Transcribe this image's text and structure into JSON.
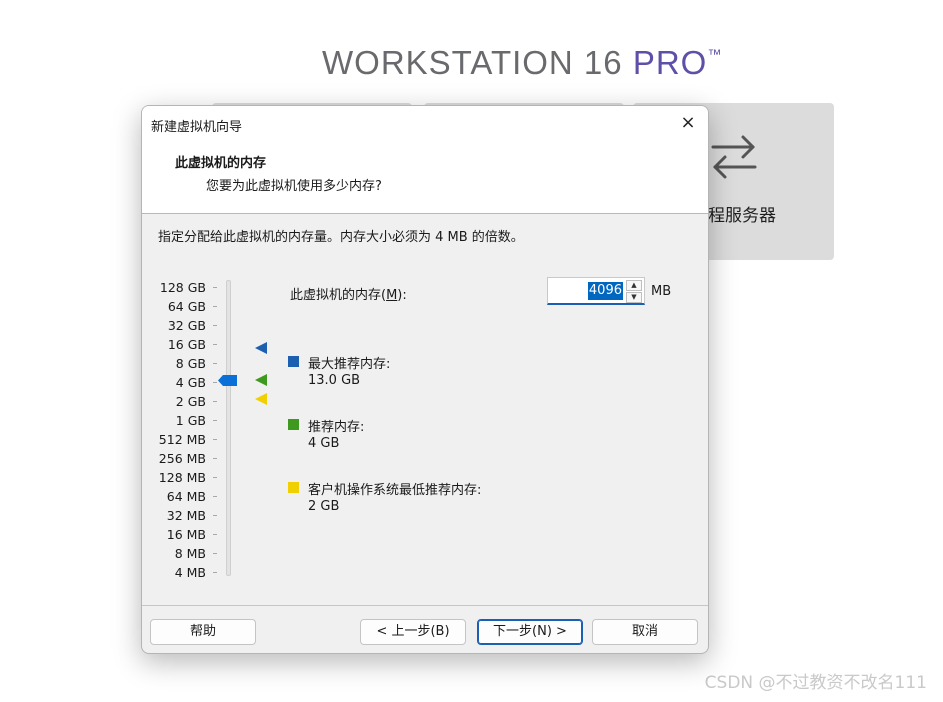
{
  "background": {
    "product_title": "WORKSTATION 16",
    "product_title_pro": "PRO",
    "product_title_tm": "™",
    "remote_server_label": "远程服务器",
    "remote_server_icon": "transfer-arrows-icon"
  },
  "watermark": "CSDN @不过教资不改名111",
  "dialog": {
    "title": "新建虚拟机向导",
    "close_icon": "×",
    "heading": "此虚拟机的内存",
    "subheading": "您要为此虚拟机使用多少内存?",
    "instruction": "指定分配给此虚拟机的内存量。内存大小必须为 4 MB 的倍数。",
    "scale_labels": [
      "128 GB",
      "64 GB",
      "32 GB",
      "16 GB",
      "8 GB",
      "4 GB",
      "2 GB",
      "1 GB",
      "512 MB",
      "256 MB",
      "128 MB",
      "64 MB",
      "32 MB",
      "16 MB",
      "8 MB",
      "4 MB"
    ],
    "memory_label_prefix": "此虚拟机的内存(",
    "memory_label_key": "M",
    "memory_label_suffix": "):",
    "memory_value": "4096",
    "memory_unit": "MB",
    "max_recommended_label": "最大推荐内存:",
    "max_recommended_value": "13.0 GB",
    "recommended_label": "推荐内存:",
    "recommended_value": "4 GB",
    "guest_min_label": "客户机操作系统最低推荐内存:",
    "guest_min_value": "2 GB",
    "colors": {
      "max": "#1c5fb0",
      "recommended": "#3e9a1f",
      "minimum": "#f0d000",
      "accent": "#0067c0"
    },
    "buttons": {
      "help": "帮助",
      "back": "< 上一步(B)",
      "next": "下一步(N) >",
      "cancel": "取消"
    }
  }
}
